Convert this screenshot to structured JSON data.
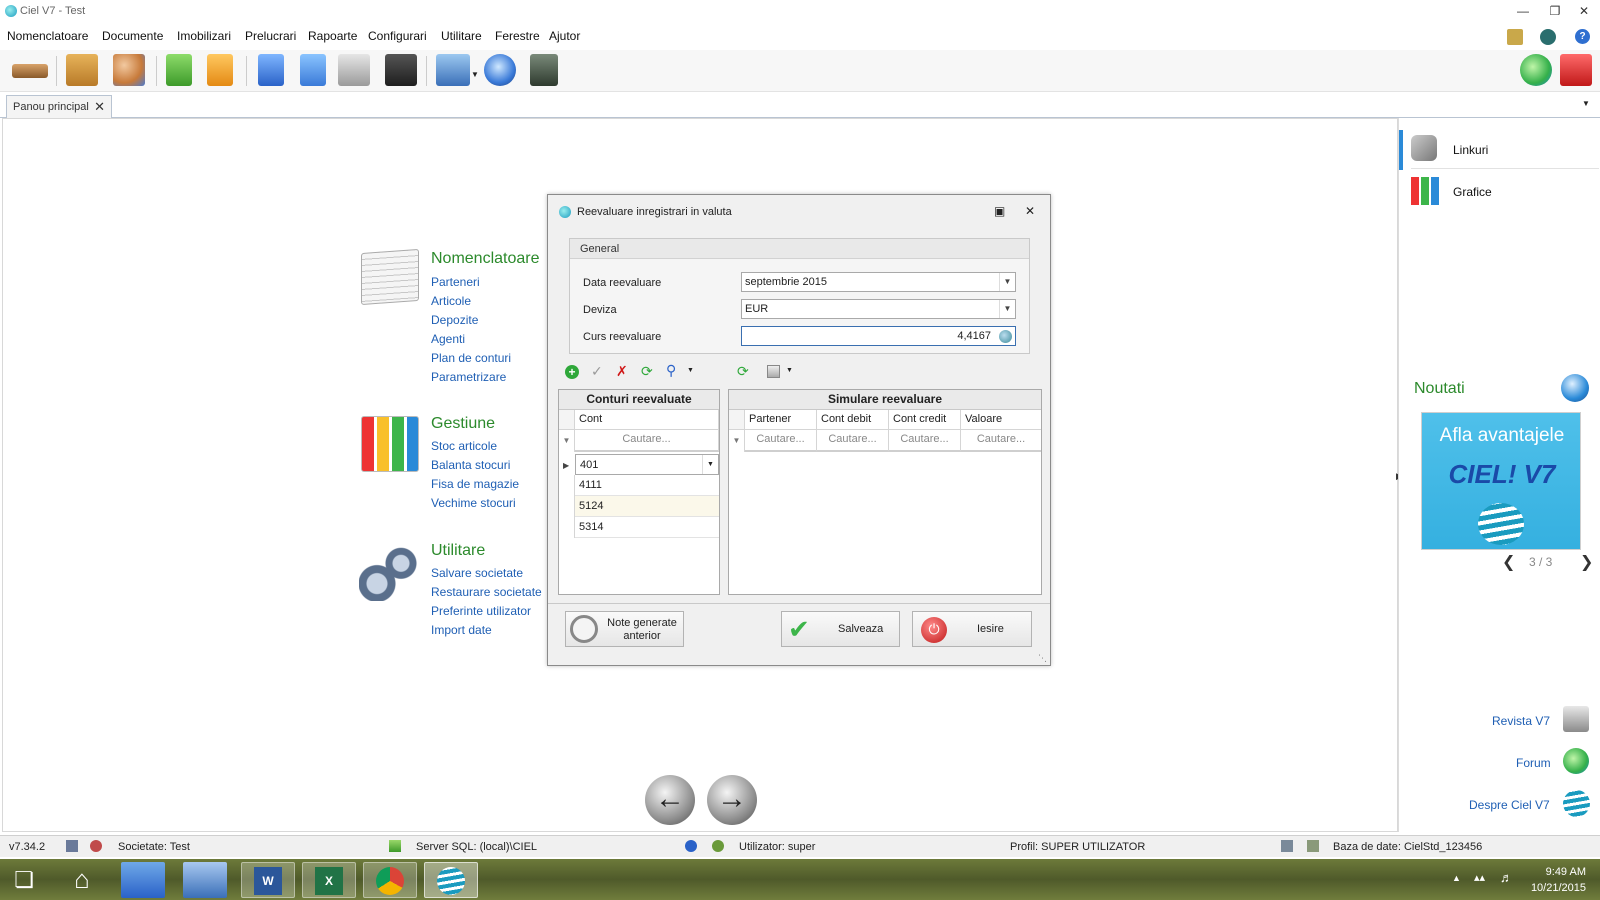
{
  "window": {
    "title": "Ciel V7 - Test"
  },
  "menu": [
    "Nomenclatoare",
    "Documente",
    "Imobilizari",
    "Prelucrari",
    "Rapoarte",
    "Configurari",
    "Utilitare",
    "Ferestre",
    "Ajutor"
  ],
  "tab": {
    "label": "Panou principal"
  },
  "sections": {
    "nomenclatoare": {
      "title": "Nomenclatoare",
      "links": [
        "Parteneri",
        "Articole",
        "Depozite",
        "Agenti",
        "Plan de conturi",
        "Parametrizare"
      ]
    },
    "gestiune": {
      "title": "Gestiune",
      "links": [
        "Stoc articole",
        "Balanta stocuri",
        "Fisa de magazie",
        "Vechime stocuri"
      ]
    },
    "utilitare": {
      "title": "Utilitare",
      "links": [
        "Salvare societate",
        "Restaurare societate",
        "Preferinte utilizator",
        "Import date"
      ]
    }
  },
  "right_panel": {
    "items": [
      "Linkuri",
      "Grafice"
    ],
    "news_title": "Noutati",
    "banner_text": "Afla avantajele",
    "banner_logo": "CIEL! V7",
    "pager": "3 / 3",
    "bottom_links": [
      "Revista V7",
      "Forum",
      "Despre Ciel V7"
    ]
  },
  "dialog": {
    "title": "Reevaluare inregistrari in valuta",
    "group_title": "General",
    "fields": {
      "data_label": "Data reevaluare",
      "data_value": "septembrie 2015",
      "deviza_label": "Deviza",
      "deviza_value": "EUR",
      "curs_label": "Curs reevaluare",
      "curs_value": "4,4167"
    },
    "left_grid": {
      "title": "Conturi reevaluate",
      "column": "Cont",
      "filter": "Cautare...",
      "rows": [
        "401",
        "4111",
        "5124",
        "5314"
      ]
    },
    "right_grid": {
      "title": "Simulare reevaluare",
      "columns": [
        "Partener",
        "Cont debit",
        "Cont credit",
        "Valoare"
      ],
      "filter": "Cautare..."
    },
    "buttons": {
      "note_line1": "Note generate",
      "note_line2": "anterior",
      "save": "Salveaza",
      "exit": "Iesire"
    }
  },
  "status": {
    "version": "v7.34.2",
    "societate": "Societate: Test",
    "server": "Server SQL: (local)\\CIEL",
    "user": "Utilizator: super",
    "profil": "Profil: SUPER UTILIZATOR",
    "db": "Baza de date: CielStd_123456"
  },
  "clock": {
    "time": "9:49 AM",
    "date": "10/21/2015"
  },
  "colors": {
    "accent_green": "#2c8a2c",
    "link_blue": "#1f5fb4"
  }
}
